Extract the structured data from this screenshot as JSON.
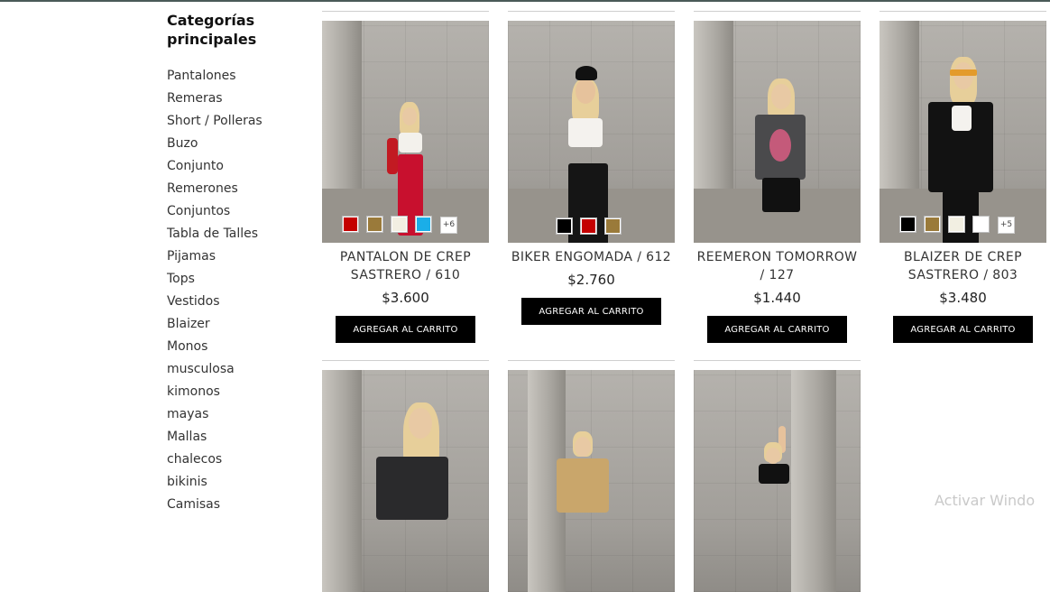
{
  "sidebar": {
    "title": "Categorías principales",
    "categories": [
      "Pantalones",
      "Remeras",
      "Short / Polleras",
      "Buzo",
      "Conjunto",
      "Remerones",
      "Conjuntos",
      "Tabla de Talles",
      "Pijamas",
      "Tops",
      "Vestidos",
      "Blaizer",
      "Monos",
      "musculosa",
      "kimonos",
      "mayas",
      "Mallas",
      "chalecos",
      "bikinis",
      "Camisas"
    ]
  },
  "products": [
    {
      "name": "PANTALON DE CREP SASTRERO / 610",
      "price": "$3.600",
      "button": "AGREGAR AL CARRITO",
      "swatches": [
        "#c40000",
        "#9a7a3a",
        "#f2efe2",
        "#1aaee8"
      ],
      "more": "+6"
    },
    {
      "name": "BIKER ENGOMADA / 612",
      "price": "$2.760",
      "button": "AGREGAR AL CARRITO",
      "swatches": [
        "#000000",
        "#c40000",
        "#9a7a3a"
      ],
      "more": ""
    },
    {
      "name": "REEMERON TOMORROW / 127",
      "price": "$1.440",
      "button": "AGREGAR AL CARRITO",
      "swatches": [],
      "more": ""
    },
    {
      "name": "BLAIZER DE CREP SASTRERO / 803",
      "price": "$3.480",
      "button": "AGREGAR AL CARRITO",
      "swatches": [
        "#000000",
        "#9a7a3a",
        "#f2efe2",
        "#ffffff"
      ],
      "more": "+5"
    }
  ],
  "watermark": "Activar Windo"
}
